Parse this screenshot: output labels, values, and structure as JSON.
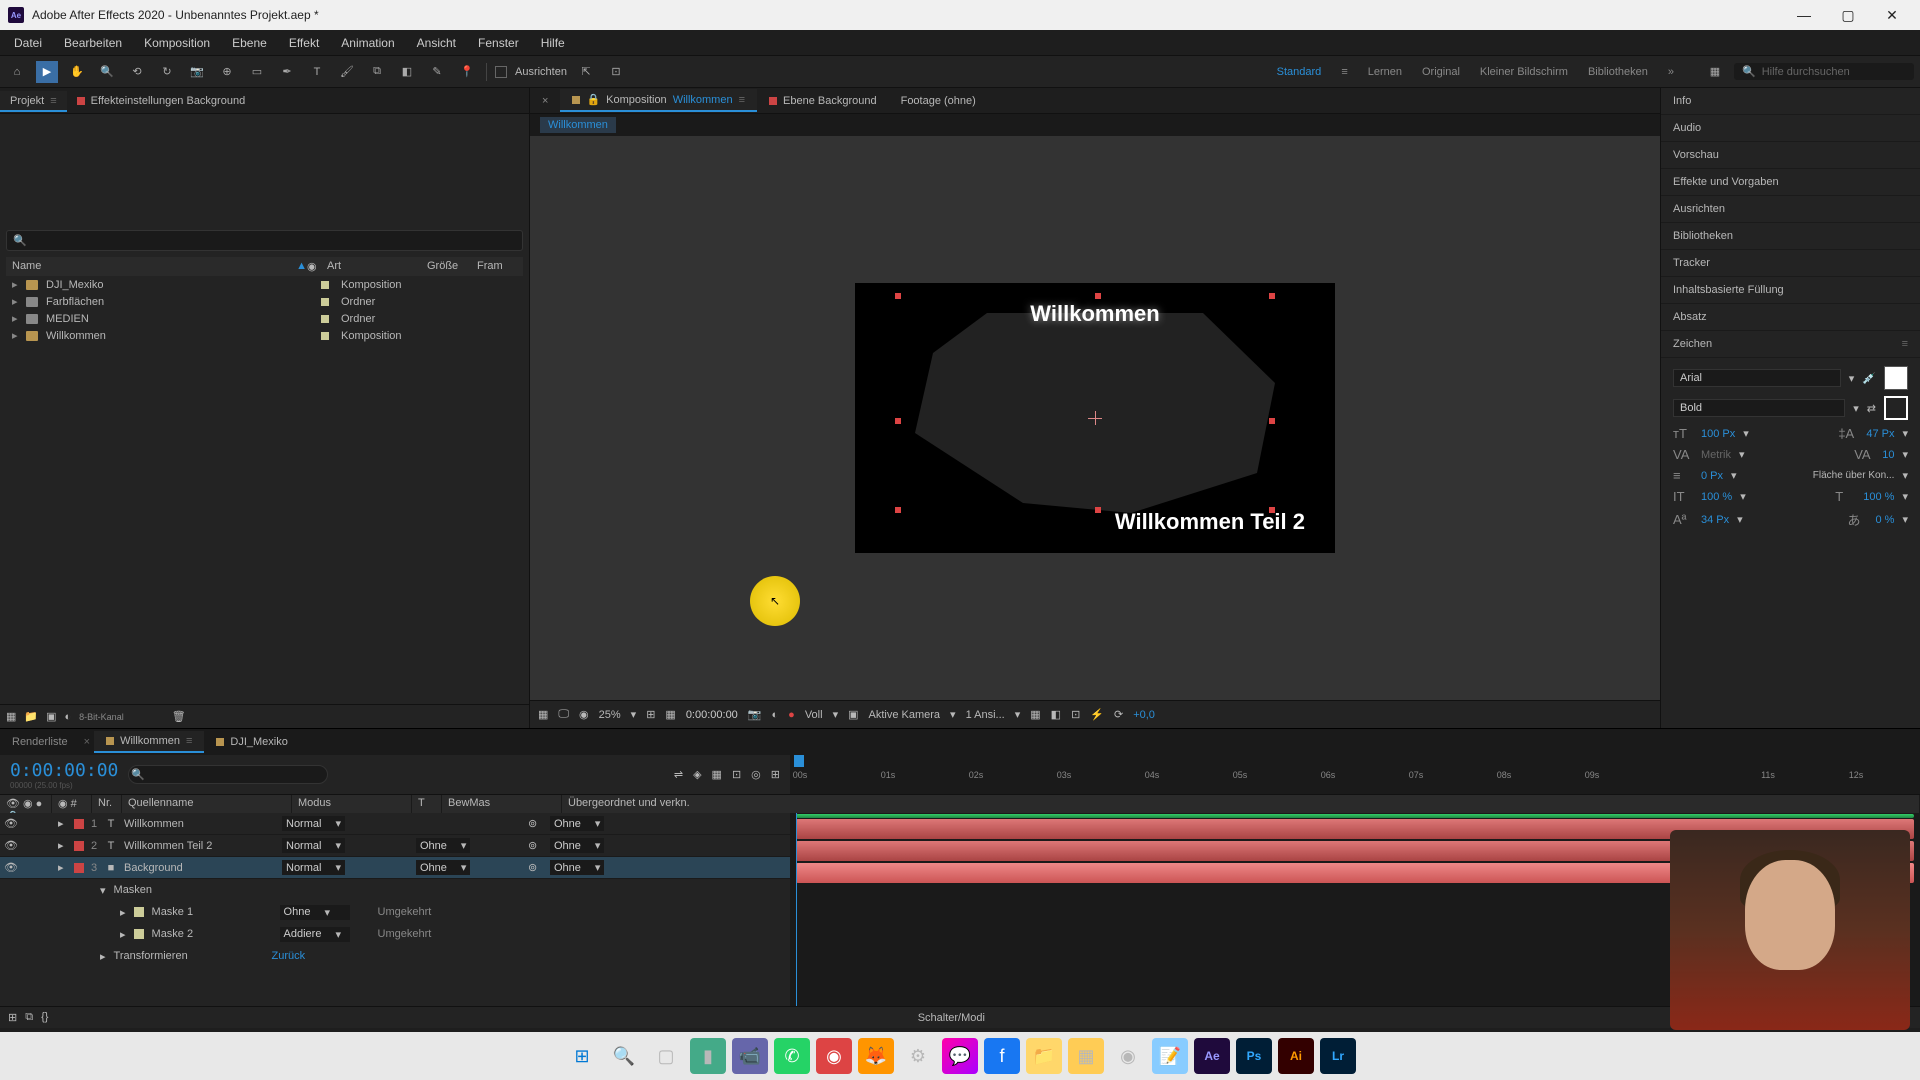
{
  "title": "Adobe After Effects 2020 - Unbenanntes Projekt.aep *",
  "menu": [
    "Datei",
    "Bearbeiten",
    "Komposition",
    "Ebene",
    "Effekt",
    "Animation",
    "Ansicht",
    "Fenster",
    "Hilfe"
  ],
  "toolbar": {
    "ausrichten": "Ausrichten",
    "search_ph": "Hilfe durchsuchen"
  },
  "workspaces": [
    "Standard",
    "Lernen",
    "Original",
    "Kleiner Bildschirm",
    "Bibliotheken"
  ],
  "project_panel": {
    "tab_project": "Projekt",
    "tab_effect": "Effekteinstellungen Background",
    "cols": {
      "name": "Name",
      "art": "Art",
      "size": "Größe",
      "fram": "Fram"
    },
    "items": [
      {
        "name": "DJI_Mexiko",
        "type": "Komposition",
        "icon": "comp"
      },
      {
        "name": "Farbflächen",
        "type": "Ordner",
        "icon": "folder"
      },
      {
        "name": "MEDIEN",
        "type": "Ordner",
        "icon": "folder"
      },
      {
        "name": "Willkommen",
        "type": "Komposition",
        "icon": "comp"
      }
    ],
    "footer_bit": "8-Bit-Kanal"
  },
  "comp_panel": {
    "tab_comp_prefix": "Komposition",
    "tab_comp_name": "Willkommen",
    "tab_layer": "Ebene Background",
    "tab_footage": "Footage (ohne)",
    "breadcrumb": "Willkommen",
    "text1": "Willkommen",
    "text2": "Willkommen Teil 2",
    "footer": {
      "zoom": "25%",
      "time": "0:00:00:00",
      "view": "Voll",
      "camera": "Aktive Kamera",
      "ansicht": "1 Ansi...",
      "exp": "+0,0"
    }
  },
  "right_panels": [
    "Info",
    "Audio",
    "Vorschau",
    "Effekte und Vorgaben",
    "Ausrichten",
    "Bibliotheken",
    "Tracker",
    "Inhaltsbasierte Füllung",
    "Absatz",
    "Zeichen"
  ],
  "char": {
    "font": "Arial",
    "weight": "Bold",
    "size": "100 Px",
    "leading": "47 Px",
    "kerning": "Metrik",
    "tracking": "10",
    "stroke": "0 Px",
    "fill_over": "Fläche über Kon...",
    "vscale": "100 %",
    "hscale": "100 %",
    "baseline": "34 Px",
    "tsume": "0 %"
  },
  "timeline": {
    "tabs": [
      "Renderliste",
      "Willkommen",
      "DJI_Mexiko"
    ],
    "timecode": "0:00:00:00",
    "subcode": "00000 (25.00 fps)",
    "cols": {
      "nr": "Nr.",
      "quelle": "Quellenname",
      "modus": "Modus",
      "t": "T",
      "bewmas": "BewMas",
      "ueber": "Übergeordnet und verkn."
    },
    "marks": [
      "00s",
      "01s",
      "02s",
      "03s",
      "04s",
      "05s",
      "06s",
      "07s",
      "08s",
      "09s",
      "11s",
      "12s"
    ],
    "layers": [
      {
        "num": "1",
        "type": "T",
        "name": "Willkommen",
        "mode": "Normal",
        "parent": "Ohne",
        "color": "red"
      },
      {
        "num": "2",
        "type": "T",
        "name": "Willkommen Teil 2",
        "mode": "Normal",
        "trk": "Ohne",
        "parent": "Ohne",
        "color": "red"
      },
      {
        "num": "3",
        "type": "",
        "name": "Background",
        "mode": "Normal",
        "trk": "Ohne",
        "parent": "Ohne",
        "color": "red",
        "selected": true
      }
    ],
    "masken": "Masken",
    "mask1": {
      "name": "Maske 1",
      "mode": "Ohne",
      "inv": "Umgekehrt"
    },
    "mask2": {
      "name": "Maske 2",
      "mode": "Addiere",
      "inv": "Umgekehrt"
    },
    "transform": "Transformieren",
    "reset": "Zurück",
    "footer": "Schalter/Modi"
  }
}
